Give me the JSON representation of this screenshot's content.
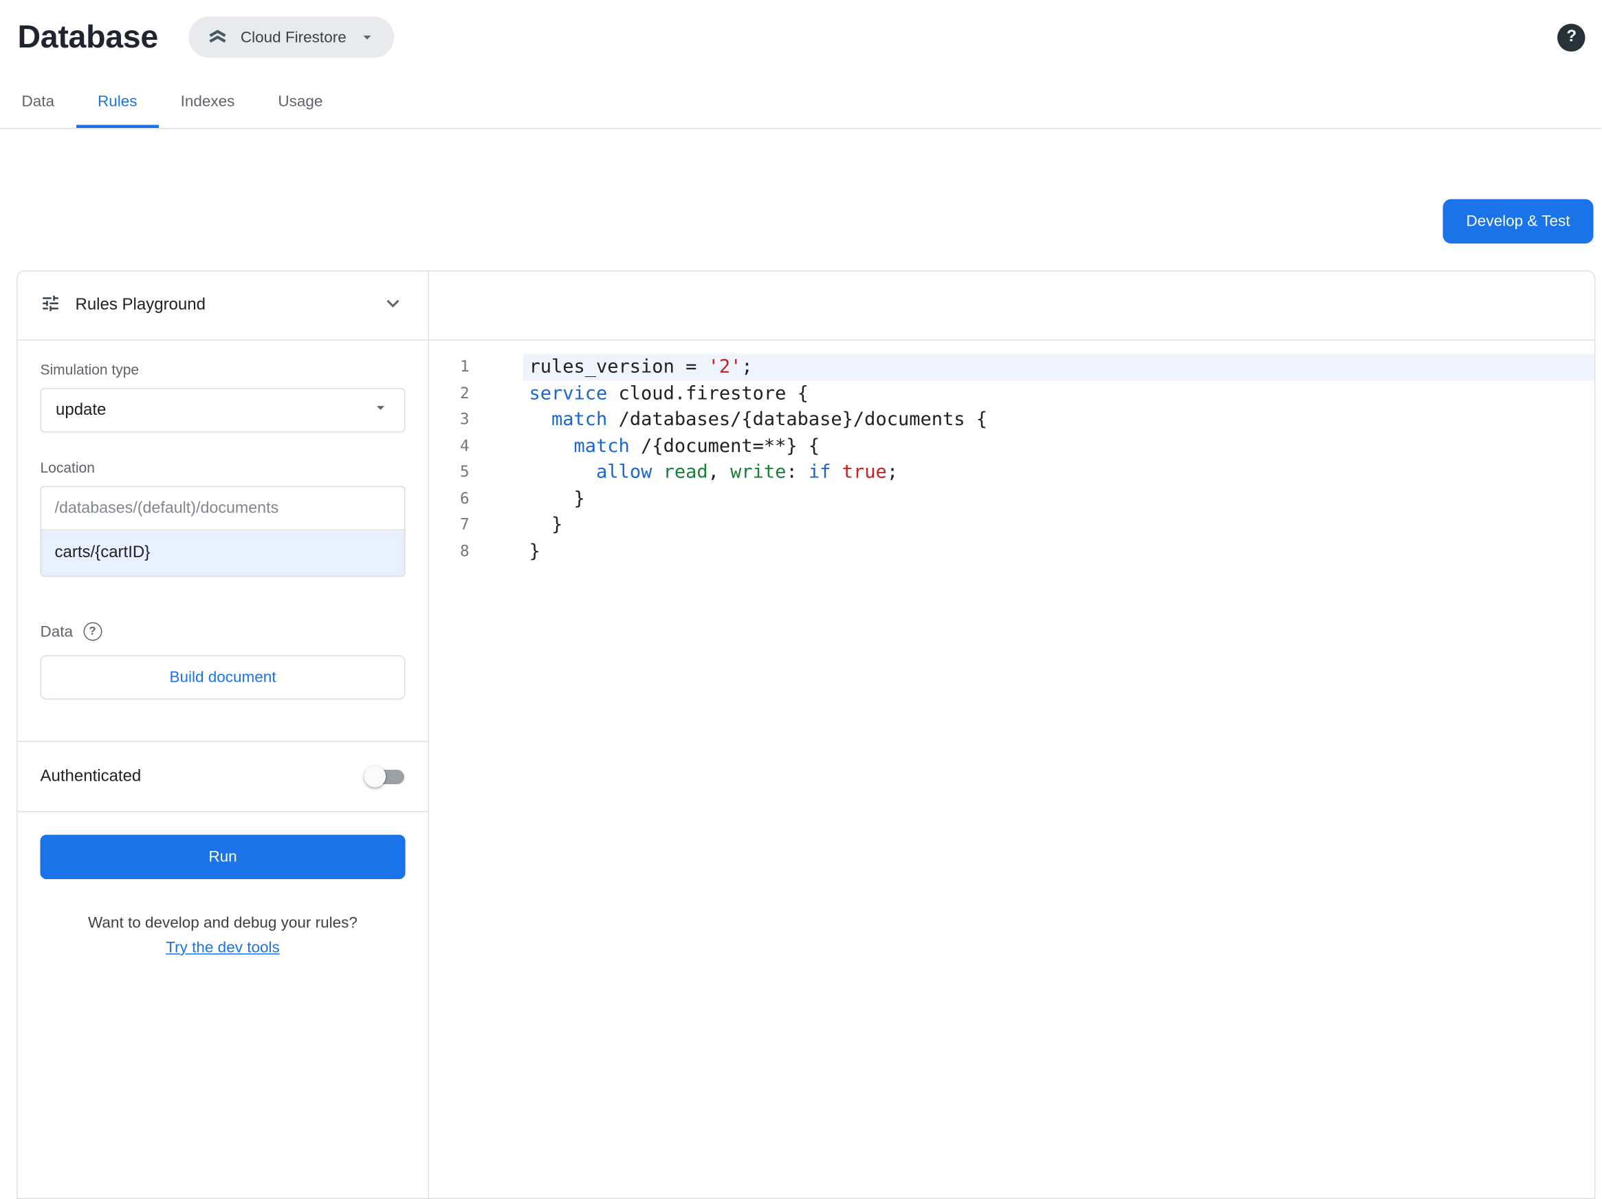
{
  "colors": {
    "accent": "#1a73e8",
    "keyword": "#1967d2",
    "string": "#c5221f",
    "identifier_green": "#188038",
    "line_highlight": "#eef3fc",
    "location_highlight": "#e8f0fe"
  },
  "header": {
    "title": "Database",
    "db_selector_label": "Cloud Firestore",
    "help_label": "?"
  },
  "tabs": [
    {
      "label": "Data"
    },
    {
      "label": "Rules"
    },
    {
      "label": "Indexes"
    },
    {
      "label": "Usage"
    }
  ],
  "active_tab": "Rules",
  "actions": {
    "develop_test": "Develop & Test"
  },
  "playground": {
    "title": "Rules Playground",
    "simulation_type": {
      "label": "Simulation type",
      "value": "update"
    },
    "location": {
      "label": "Location",
      "base_path": "/databases/(default)/documents",
      "value": "carts/{cartID}"
    },
    "data_section": {
      "label": "Data",
      "help": "?"
    },
    "build_document": "Build document",
    "authenticated": {
      "label": "Authenticated",
      "enabled": false
    },
    "run": "Run",
    "dev_tools": {
      "prompt": "Want to develop and debug your rules?",
      "link": "Try the dev tools"
    }
  },
  "editor": {
    "lines": [
      {
        "number": "1",
        "highlighted": true,
        "segments": [
          {
            "type": "plain",
            "text": "rules_version = "
          },
          {
            "type": "string",
            "text": "'2'"
          },
          {
            "type": "plain",
            "text": ";"
          }
        ]
      },
      {
        "number": "2",
        "highlighted": false,
        "segments": [
          {
            "type": "keyword",
            "text": "service"
          },
          {
            "type": "plain",
            "text": " cloud.firestore {"
          }
        ]
      },
      {
        "number": "3",
        "highlighted": false,
        "segments": [
          {
            "type": "plain",
            "text": "  "
          },
          {
            "type": "keyword",
            "text": "match"
          },
          {
            "type": "plain",
            "text": " /databases/{database}/documents {"
          }
        ]
      },
      {
        "number": "4",
        "highlighted": false,
        "segments": [
          {
            "type": "plain",
            "text": "    "
          },
          {
            "type": "keyword",
            "text": "match"
          },
          {
            "type": "plain",
            "text": " /{document=**} {"
          }
        ]
      },
      {
        "number": "5",
        "highlighted": false,
        "segments": [
          {
            "type": "plain",
            "text": "      "
          },
          {
            "type": "keyword",
            "text": "allow"
          },
          {
            "type": "plain",
            "text": " "
          },
          {
            "type": "method",
            "text": "read"
          },
          {
            "type": "plain",
            "text": ", "
          },
          {
            "type": "method",
            "text": "write"
          },
          {
            "type": "plain",
            "text": ": "
          },
          {
            "type": "keyword",
            "text": "if"
          },
          {
            "type": "plain",
            "text": " "
          },
          {
            "type": "literal",
            "text": "true"
          },
          {
            "type": "plain",
            "text": ";"
          }
        ]
      },
      {
        "number": "6",
        "highlighted": false,
        "segments": [
          {
            "type": "plain",
            "text": "    }"
          }
        ]
      },
      {
        "number": "7",
        "highlighted": false,
        "segments": [
          {
            "type": "plain",
            "text": "  }"
          }
        ]
      },
      {
        "number": "8",
        "highlighted": false,
        "segments": [
          {
            "type": "plain",
            "text": "}"
          }
        ]
      }
    ]
  }
}
